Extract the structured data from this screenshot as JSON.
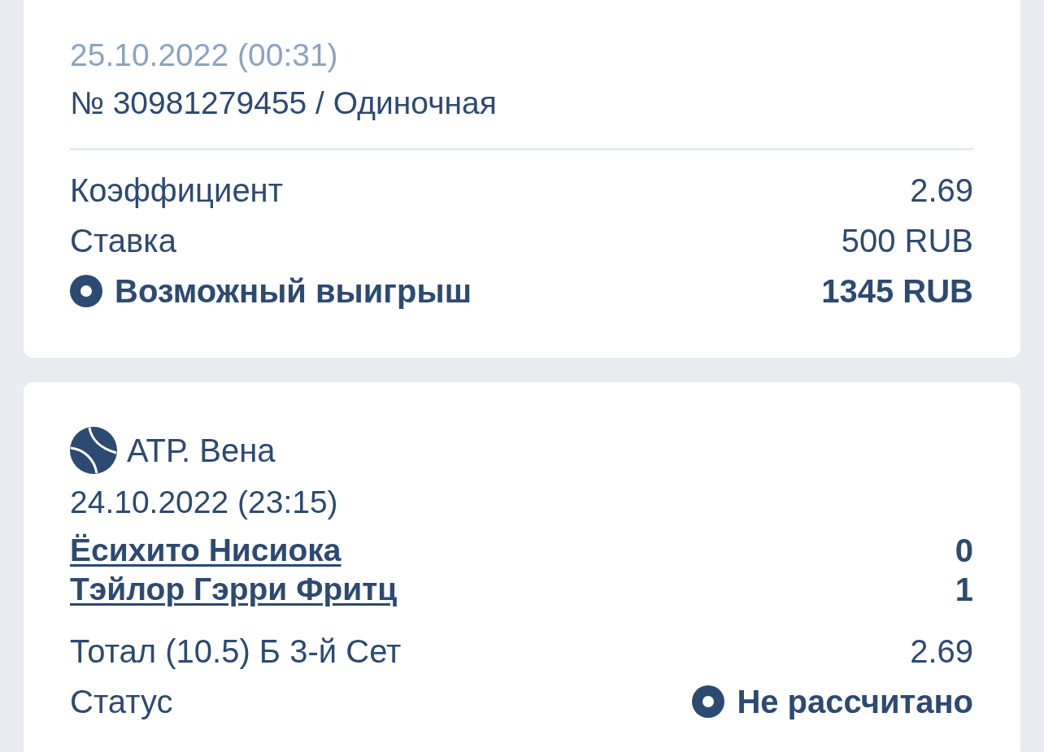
{
  "bet": {
    "date": "25.10.2022 (00:31)",
    "number": "№ 30981279455 / Одиночная",
    "rows": [
      {
        "kind": "plain",
        "label": "Коэффициент",
        "value": "2.69"
      },
      {
        "kind": "plain",
        "label": "Ставка",
        "value": "500 RUB"
      },
      {
        "kind": "highlight",
        "label": "Возможный выигрыш",
        "value": "1345 RUB"
      }
    ]
  },
  "event": {
    "tournament": "АТР. Вена",
    "date": "24.10.2022 (23:15)",
    "players": [
      {
        "name": "Ёсихито Нисиока",
        "score": "0"
      },
      {
        "name": "Тэйлор Гэрри Фритц",
        "score": "1"
      }
    ],
    "rows": [
      {
        "kind": "plain",
        "label": "Тотал (10.5) Б 3-й Сет",
        "value": "2.69"
      },
      {
        "kind": "status",
        "label": "Статус",
        "value": "Не рассчитано"
      }
    ]
  }
}
